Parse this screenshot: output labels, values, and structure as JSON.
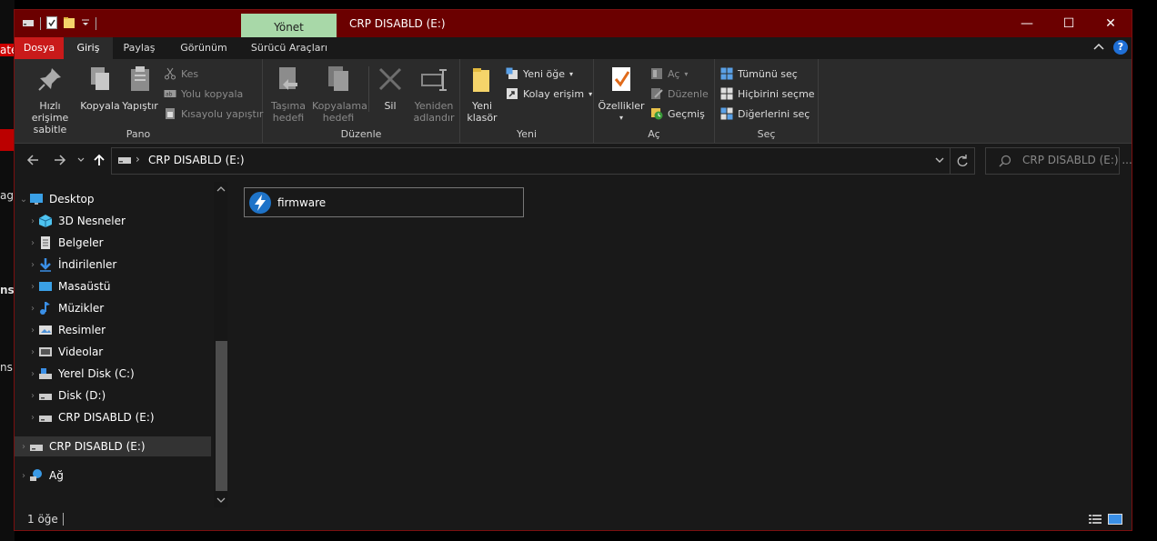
{
  "background_app": {
    "fragments": [
      "ate",
      "ag",
      "ns",
      "ns"
    ]
  },
  "window": {
    "title": "CRP DISABLD (E:)",
    "contextual_tab": "Yönet",
    "controls": {
      "minimize": "—",
      "maximize": "☐",
      "close": "✕"
    }
  },
  "ribbon_tabs": [
    "Dosya",
    "Giriş",
    "Paylaş",
    "Görünüm",
    "Sürücü Araçları"
  ],
  "ribbon": {
    "pano": {
      "label": "Pano",
      "pin": [
        "Hızlı erişime",
        "sabitle"
      ],
      "copy": "Kopyala",
      "paste": "Yapıştır",
      "cut": "Kes",
      "copy_path": "Yolu kopyala",
      "paste_shortcut": "Kısayolu yapıştır"
    },
    "duzenle": {
      "label": "Düzenle",
      "move_to": [
        "Taşıma",
        "hedefi"
      ],
      "copy_to": [
        "Kopyalama",
        "hedefi"
      ],
      "delete": "Sil",
      "rename": [
        "Yeniden",
        "adlandır"
      ]
    },
    "yeni": {
      "label": "Yeni",
      "new_folder": [
        "Yeni",
        "klasör"
      ],
      "new_item": "Yeni öğe",
      "easy_access": "Kolay erişim"
    },
    "ac": {
      "label": "Aç",
      "properties": "Özellikler",
      "open": "Aç",
      "edit": "Düzenle",
      "history": "Geçmiş"
    },
    "sec": {
      "label": "Seç",
      "select_all": "Tümünü seç",
      "select_none": "Hiçbirini seçme",
      "invert": "Diğerlerini seç"
    }
  },
  "address": {
    "path": "CRP DISABLD (E:)",
    "search_placeholder": "CRP DISABLD (E:) ..."
  },
  "nav": {
    "items": [
      {
        "label": "Desktop",
        "icon": "desktop-icon"
      },
      {
        "label": "3D Nesneler",
        "icon": "3d-objects-icon"
      },
      {
        "label": "Belgeler",
        "icon": "documents-icon"
      },
      {
        "label": "İndirilenler",
        "icon": "downloads-icon"
      },
      {
        "label": "Masaüstü",
        "icon": "desktop-folder-icon"
      },
      {
        "label": "Müzikler",
        "icon": "music-icon"
      },
      {
        "label": "Resimler",
        "icon": "pictures-icon"
      },
      {
        "label": "Videolar",
        "icon": "videos-icon"
      },
      {
        "label": "Yerel Disk (C:)",
        "icon": "system-drive-icon"
      },
      {
        "label": "Disk (D:)",
        "icon": "drive-icon"
      },
      {
        "label": "CRP DISABLD (E:)",
        "icon": "drive-icon"
      },
      {
        "label": "CRP DISABLD (E:)",
        "icon": "drive-icon"
      },
      {
        "label": "Ağ",
        "icon": "network-icon"
      }
    ]
  },
  "content": {
    "items": [
      {
        "name": "firmware",
        "icon": "firmware-app-icon"
      }
    ]
  },
  "status": {
    "count": "1 öğe"
  },
  "colors": {
    "titlebar": "#6b0000",
    "accent_red": "#c91a1a",
    "context_tab": "#a8d8a8",
    "window_bg": "#191919",
    "ribbon_bg": "#2b2b2b"
  }
}
